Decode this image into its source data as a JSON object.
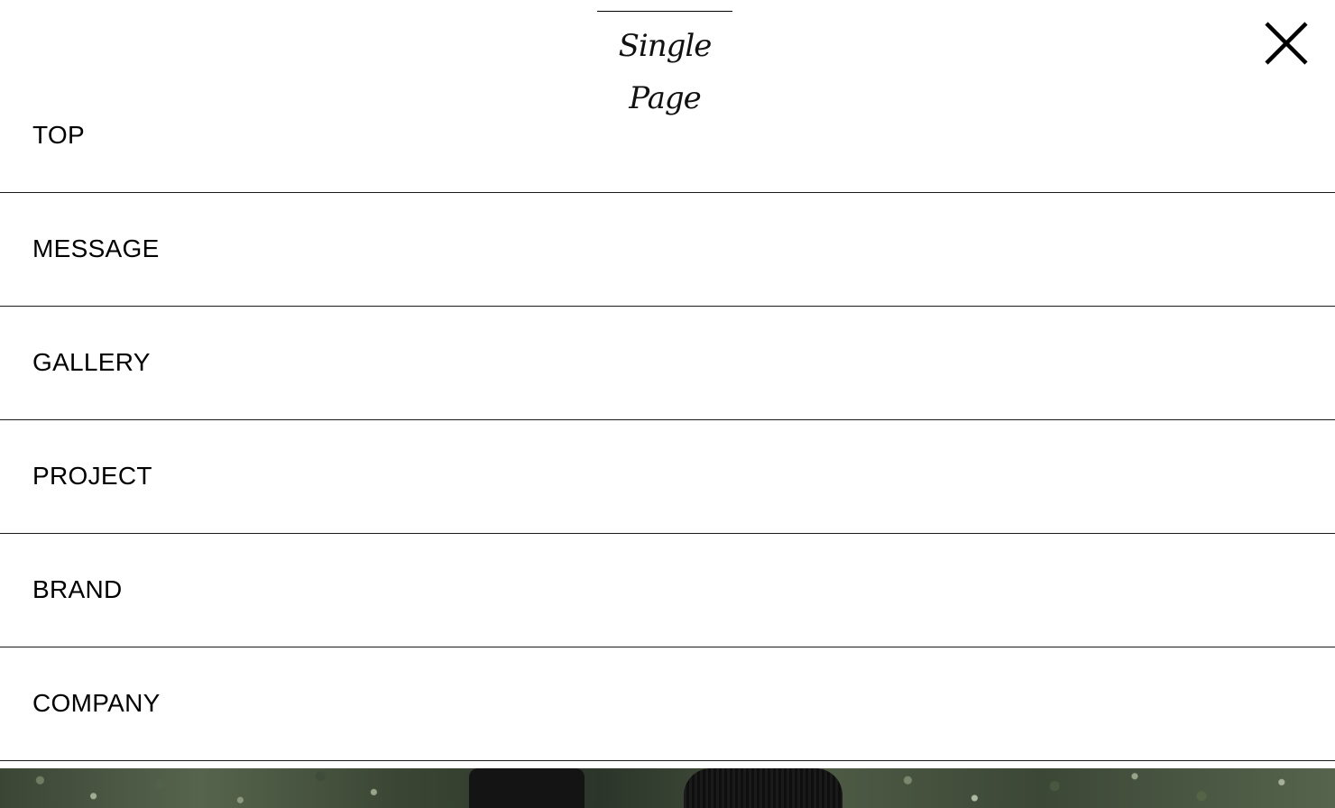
{
  "header": {
    "logo_text": "Single Page",
    "close_icon": "close-icon"
  },
  "menu": {
    "items": [
      {
        "label": "TOP"
      },
      {
        "label": "MESSAGE"
      },
      {
        "label": "GALLERY"
      },
      {
        "label": "PROJECT"
      },
      {
        "label": "BRAND"
      },
      {
        "label": "COMPANY"
      }
    ]
  },
  "colors": {
    "background": "#ffffff",
    "text": "#000000",
    "divider": "#1a1a1a"
  }
}
